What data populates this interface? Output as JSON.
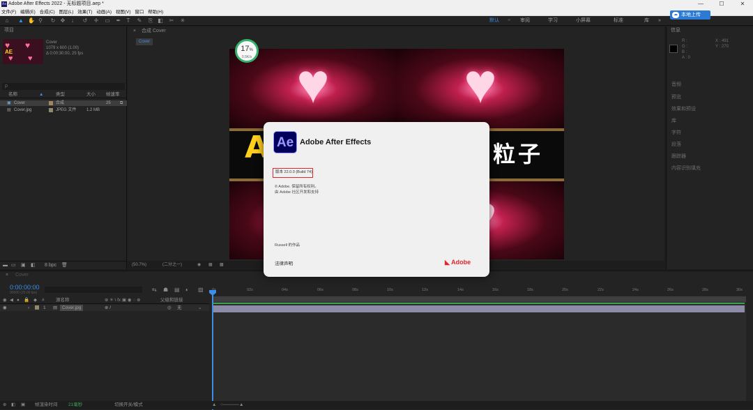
{
  "titlebar": {
    "app_icon": "Ae",
    "title": "Adobe After Effects 2022 - 无标题项目.aep *",
    "min": "—",
    "max": "☐",
    "close": "✕"
  },
  "menu": [
    "文件(F)",
    "编辑(E)",
    "合成(C)",
    "图层(L)",
    "效果(T)",
    "动画(A)",
    "视图(V)",
    "窗口",
    "帮助(H)"
  ],
  "workspaces": [
    {
      "label": "默认",
      "active": true
    },
    {
      "label": "审阅",
      "active": false
    },
    {
      "label": "学习",
      "active": false
    },
    {
      "label": "小屏幕",
      "active": false
    },
    {
      "label": "标准",
      "active": false
    },
    {
      "label": "库",
      "active": false
    }
  ],
  "cloud_button": "本地上传",
  "project": {
    "tab": "项目",
    "comp_name": "Cover",
    "comp_dims": "1079 x 600 (1.00)",
    "comp_dur": "Δ 0:00:30:00, 25 fps",
    "thumb_text": "AE",
    "search_placeholder": "ρ",
    "cols": {
      "name": "名称",
      "type": "类型",
      "size": "大小",
      "fps": "帧速率"
    },
    "rows": [
      {
        "name": "Cover",
        "type": "合成",
        "size": "",
        "fps": "25"
      },
      {
        "name": "Cover.jpg",
        "type": "JPEG 文件",
        "size": "1.2 MB",
        "fps": ""
      }
    ],
    "bpc": "8 bpc"
  },
  "comp": {
    "tab": "合成 Cover",
    "sub_tab": "Cover",
    "big_left": "AE",
    "big_right": "粒子",
    "progress_pct": "17",
    "progress_unit": "%",
    "progress_sub": "0.5K/s",
    "footer_zoom": "(50.7%)",
    "footer_quality": "(二分之一)"
  },
  "splash": {
    "logo": "Ae",
    "title": "Adobe After Effects",
    "version": "版本 22.0.0 (Build 74)",
    "line1": "© Adobe. 保留所有权利。",
    "line2": "由 Adobe 社区开发和支持",
    "line3": "Russell 的作品",
    "credits": "法律声明",
    "brand": "Adobe"
  },
  "info_panel": {
    "tab": "信息",
    "r": "R :",
    "g": "G :",
    "b": "B :",
    "a": "A : 0",
    "x": "X : 491",
    "y": "Y : 270",
    "items": [
      "音频",
      "预览",
      "效果和预设",
      "库",
      "字符",
      "段落",
      "跟踪器",
      "内容识别填充"
    ]
  },
  "timeline": {
    "tab": "Cover",
    "timecode": "0:00:00:00",
    "tc_sub": "00000 (25.00 fps)",
    "layer_head": "源名称",
    "parent_head": "父级和链接",
    "layer_num": "1",
    "layer_name": "Cover.jpg",
    "layer_parent": "无",
    "ruler": [
      "0s",
      "02s",
      "04s",
      "06s",
      "08s",
      "10s",
      "12s",
      "14s",
      "16s",
      "18s",
      "20s",
      "22s",
      "24s",
      "26s",
      "28s",
      "30s"
    ],
    "footer_render": "帧渲染时间",
    "footer_time": "21毫秒",
    "footer_toggle": "切换开关/模式"
  }
}
